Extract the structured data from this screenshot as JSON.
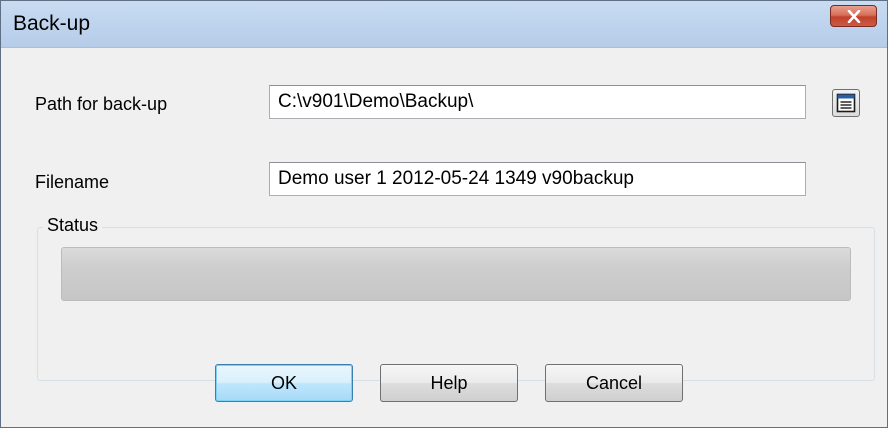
{
  "window": {
    "title": "Back-up",
    "close_label": "close"
  },
  "form": {
    "path_label": "Path for back-up",
    "path_value": "C:\\v901\\Demo\\Backup\\",
    "filename_label": "Filename",
    "filename_value": "Demo user 1 2012-05-24 1349 v90backup"
  },
  "status": {
    "group_label": "Status",
    "progress_fraction": 0
  },
  "buttons": {
    "ok_label": "OK",
    "help_label": "Help",
    "cancel_label": "Cancel"
  },
  "icons": {
    "close": "close-icon",
    "browse": "folder-browse-icon"
  },
  "colors": {
    "titlebar": "#bfd4ee",
    "close_button": "#c2412b",
    "default_button_border": "#3c7fb1"
  }
}
